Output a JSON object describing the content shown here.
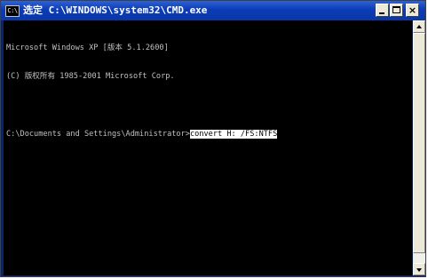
{
  "window": {
    "title": "选定 C:\\WINDOWS\\system32\\CMD.exe",
    "icon_text": "C:\\",
    "controls": {
      "minimize_icon": "minimize-icon",
      "maximize_icon": "maximize-icon",
      "close_icon": "close-icon",
      "close_glyph": "×"
    }
  },
  "console": {
    "lines": [
      "Microsoft Windows XP [版本 5.1.2600]",
      "(C) 版权所有 1985-2001 Microsoft Corp.",
      ""
    ],
    "prompt": "C:\\Documents and Settings\\Administrator>",
    "selected_command": "convert H: /FS:NTFS"
  },
  "colors": {
    "console_bg": "#000000",
    "console_text": "#c0c0c0",
    "selection_bg": "#ffffff",
    "selection_text": "#000000",
    "titlebar": "#0b3bb8"
  }
}
